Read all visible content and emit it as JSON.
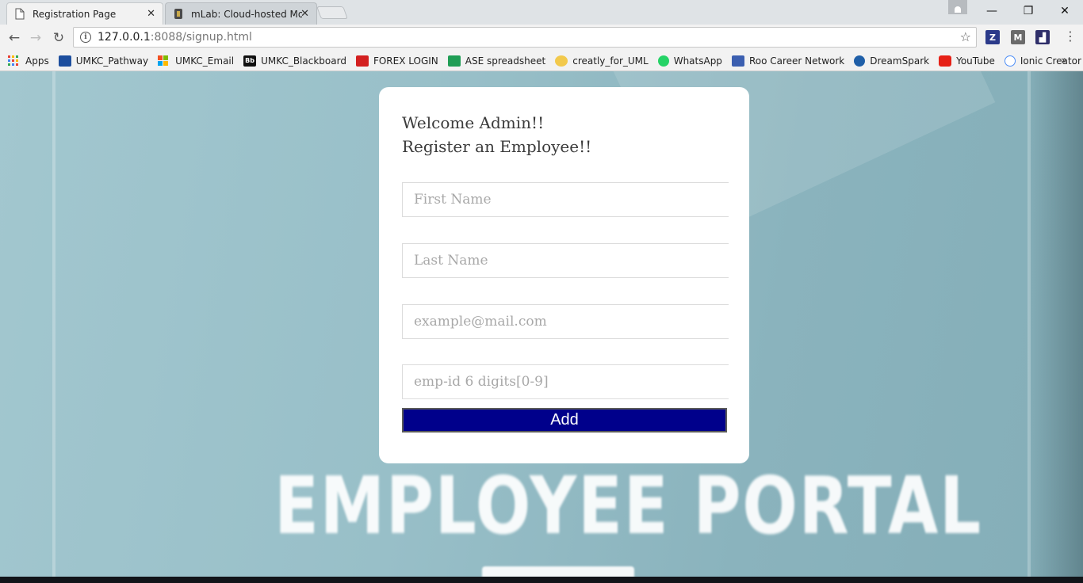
{
  "browser": {
    "tabs": [
      {
        "title": "Registration Page",
        "close": "✕",
        "active": true
      },
      {
        "title": "mLab: Cloud-hosted Mo",
        "close": "✕",
        "active": false
      }
    ],
    "window_controls": {
      "minimize": "—",
      "restore": "❐",
      "close": "✕"
    },
    "nav": {
      "back": "←",
      "forward": "→",
      "reload": "↻"
    },
    "url": {
      "host": "127.0.0.1",
      "rest": ":8088/signup.html"
    },
    "star": "☆",
    "extensions": [
      {
        "name": "zotero-icon",
        "label": "Z",
        "color": "#2b3a8a"
      },
      {
        "name": "extension-m-icon",
        "label": "M",
        "color": "#6a6a6a"
      },
      {
        "name": "extension-chart-icon",
        "label": "▟",
        "color": "#2f2f6a"
      }
    ],
    "menu": "⋮"
  },
  "bookmarks": {
    "items": [
      {
        "label": "Apps",
        "icon": "apps-grid-icon",
        "color": "#e94235"
      },
      {
        "label": "UMKC_Pathway",
        "icon": "umkc-icon",
        "color": "#1d4e9e"
      },
      {
        "label": "UMKC_Email",
        "icon": "microsoft-icon",
        "color": "#f25022"
      },
      {
        "label": "UMKC_Blackboard",
        "icon": "blackboard-icon",
        "color": "#111111"
      },
      {
        "label": "FOREX LOGIN",
        "icon": "forex-icon",
        "color": "#d32020"
      },
      {
        "label": "ASE spreadsheet",
        "icon": "sheets-icon",
        "color": "#1f9d55"
      },
      {
        "label": "creatly_for_UML",
        "icon": "creately-icon",
        "color": "#f2c94c"
      },
      {
        "label": "WhatsApp",
        "icon": "whatsapp-icon",
        "color": "#25d366"
      },
      {
        "label": "Roo Career Network",
        "icon": "roo-icon",
        "color": "#3b5fb0"
      },
      {
        "label": "DreamSpark",
        "icon": "dreamspark-icon",
        "color": "#1f5fa8"
      },
      {
        "label": "YouTube",
        "icon": "youtube-icon",
        "color": "#e62117"
      },
      {
        "label": "Ionic Creator",
        "icon": "ionic-icon",
        "color": "#4e8ef7"
      }
    ],
    "more": "»"
  },
  "form": {
    "heading_line1": "Welcome Admin!!",
    "heading_line2": "Register an Employee!!",
    "first_name_placeholder": "First Name",
    "last_name_placeholder": "Last Name",
    "email_placeholder": "example@mail.com",
    "emp_id_placeholder": "emp-id 6 digits[0-9]",
    "add_label": "Add"
  },
  "background_title": "EMPLOYEE PORTAL",
  "colors": {
    "add_button": "#00008b",
    "page_background": "#8fb7c2"
  }
}
